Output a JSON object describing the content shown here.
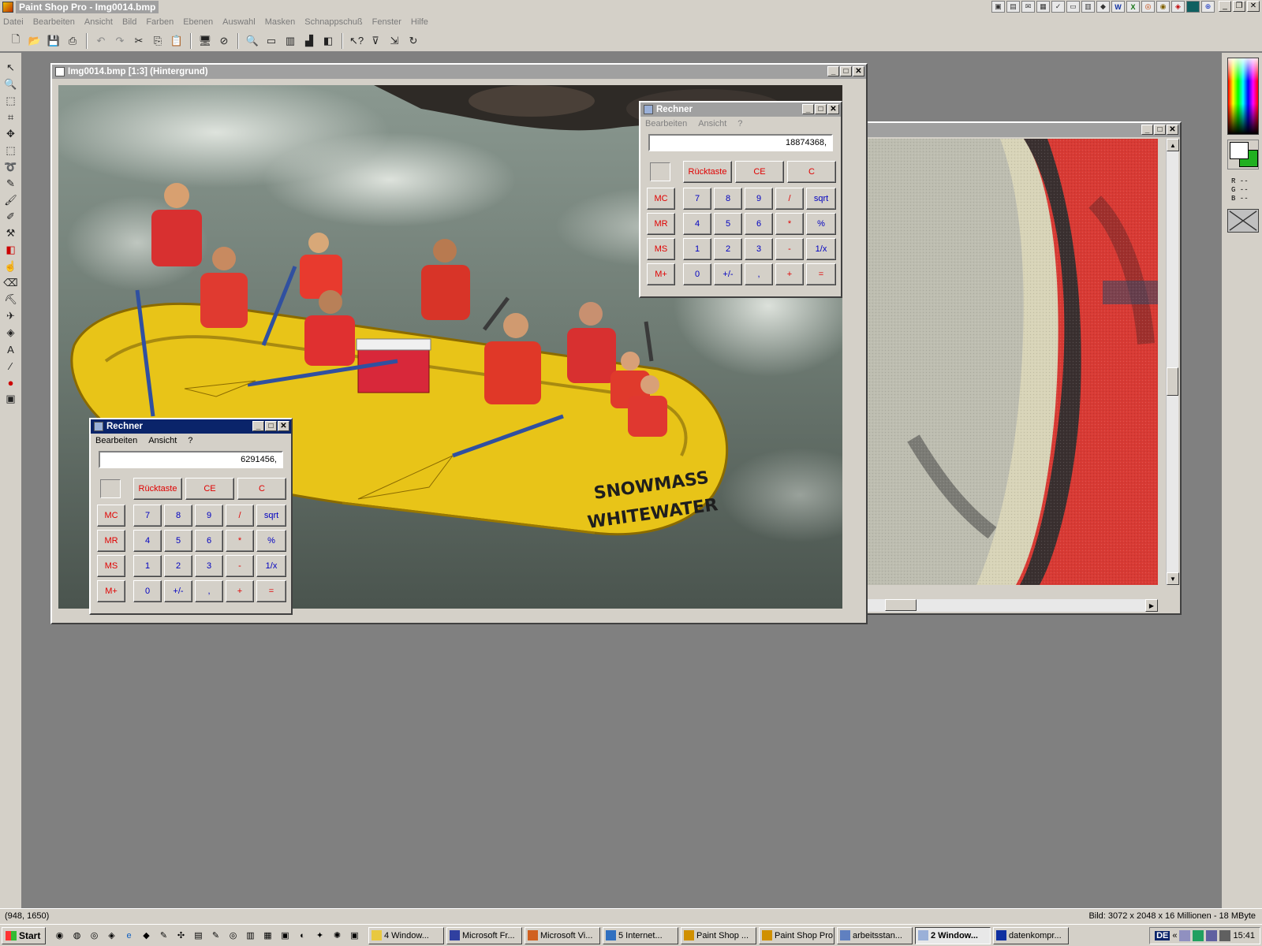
{
  "app": {
    "title": "Paint Shop Pro - Img0014.bmp",
    "menu": [
      "Datei",
      "Bearbeiten",
      "Ansicht",
      "Bild",
      "Farben",
      "Ebenen",
      "Auswahl",
      "Masken",
      "Schnappschuß",
      "Fenster",
      "Hilfe"
    ]
  },
  "image_window": {
    "title": "Img0014.bmp [1:3] (Hintergrund)",
    "raft_text_1": "SNOWMASS",
    "raft_text_2": "WHITEWATER"
  },
  "calc_top": {
    "title": "Rechner",
    "menu": [
      "Bearbeiten",
      "Ansicht",
      "?"
    ],
    "display": "18874368,"
  },
  "calc_bottom": {
    "title": "Rechner",
    "menu": [
      "Bearbeiten",
      "Ansicht",
      "?"
    ],
    "display": "6291456,"
  },
  "calc_buttons": {
    "backspace": "Rücktaste",
    "ce": "CE",
    "c": "C",
    "mc": "MC",
    "mr": "MR",
    "ms": "MS",
    "mplus": "M+",
    "n7": "7",
    "n8": "8",
    "n9": "9",
    "div": "/",
    "sqrt": "sqrt",
    "n4": "4",
    "n5": "5",
    "n6": "6",
    "mul": "*",
    "pct": "%",
    "n1": "1",
    "n2": "2",
    "n3": "3",
    "sub": "-",
    "inv": "1/x",
    "n0": "0",
    "sign": "+/-",
    "dot": ",",
    "add": "+",
    "eq": "="
  },
  "color_panel": {
    "r": "R --",
    "g": "G --",
    "b": "B --",
    "foreground": "#ffffff",
    "background": "#20b020"
  },
  "status": {
    "coords": "(948, 1650)",
    "info": "Bild:  3072 x 2048 x 16 Millionen - 18 MByte"
  },
  "taskbar": {
    "start": "Start",
    "tasks": [
      "4 Window...",
      "Microsoft Fr...",
      "Microsoft Vi...",
      "5 Internet...",
      "Paint Shop ...",
      "Paint Shop Pro",
      "arbeitsstan...",
      "2 Window...",
      "datenkompr..."
    ],
    "tray_lang": "DE",
    "clock": "15:41"
  }
}
